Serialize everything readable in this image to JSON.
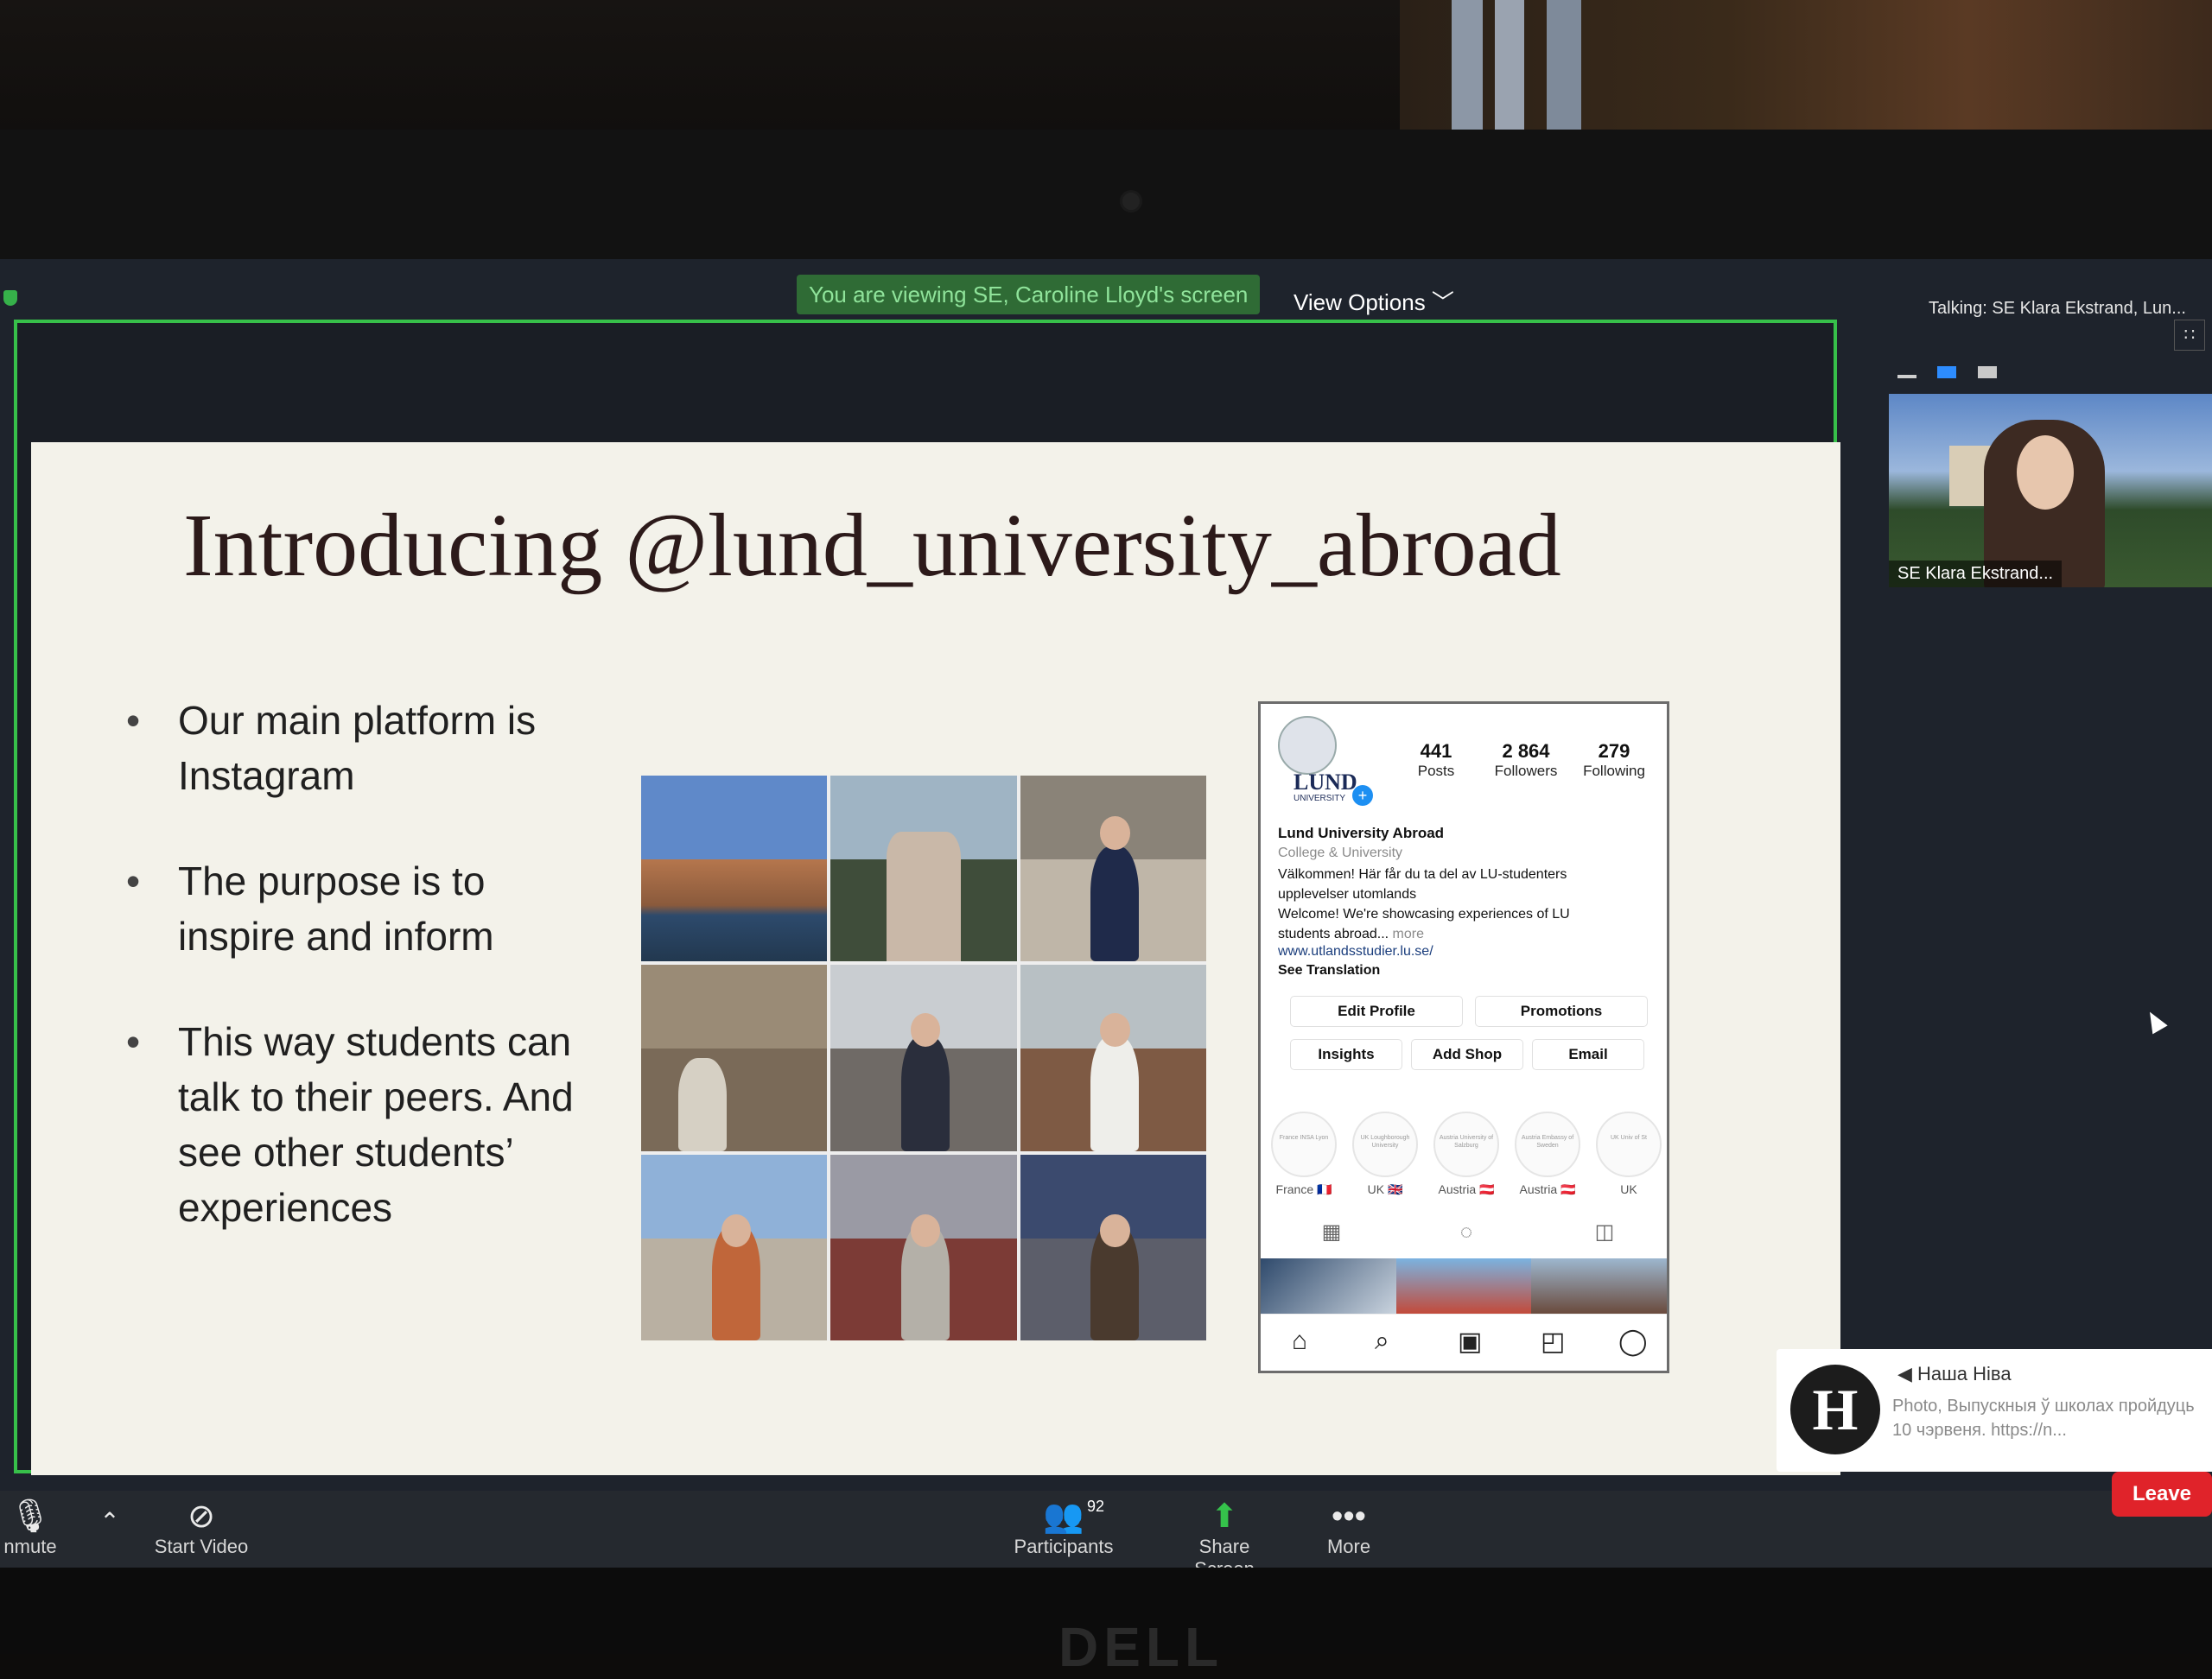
{
  "banner": {
    "viewing_text": "You are viewing SE, Caroline Lloyd's screen",
    "view_options": "View Options ﹀",
    "talking": "Talking: SE Klara Ekstrand, Lun..."
  },
  "slide": {
    "title": "Introducing @lund_university_abroad",
    "bullets": [
      "Our main platform is Instagram",
      "The purpose is to inspire and inform",
      "This way students can talk to their peers. And see other students’ experiences"
    ]
  },
  "instagram": {
    "logo_text": "LUND",
    "logo_subtext": "UNIVERSITY",
    "posts_count": "441",
    "posts_label": "Posts",
    "followers_count": "2 864",
    "followers_label": "Followers",
    "following_count": "279",
    "following_label": "Following",
    "name": "Lund University Abroad",
    "category": "College & University",
    "bio_line1": "Välkommen! Här får du ta del av LU-studenters",
    "bio_line2": "upplevelser utomlands",
    "bio_line3": "Welcome! We're showcasing experiences of LU",
    "bio_line4": "students abroad...",
    "bio_more": "more",
    "link": "www.utlandsstudier.lu.se/",
    "see_translation": "See Translation",
    "buttons": {
      "edit_profile": "Edit Profile",
      "promotions": "Promotions",
      "insights": "Insights",
      "add_shop": "Add Shop",
      "email": "Email"
    },
    "highlights": [
      {
        "ring_text": "France INSA Lyon",
        "caption": "France 🇫🇷"
      },
      {
        "ring_text": "UK Loughborough University",
        "caption": "UK 🇬🇧"
      },
      {
        "ring_text": "Austria University of Salzburg",
        "caption": "Austria 🇦🇹"
      },
      {
        "ring_text": "Austria Embassy of Sweden",
        "caption": "Austria 🇦🇹"
      },
      {
        "ring_text": "UK Univ of St",
        "caption": "UK"
      }
    ]
  },
  "video": {
    "participant_name": "SE Klara Ekstrand..."
  },
  "notification": {
    "logo_letter": "H",
    "title": "Наша Ніва",
    "text": "Photo, Выпускныя ў школах пройдуць 10 чэрвеня. https://n..."
  },
  "toolbar": {
    "unmute_label": "nmute",
    "start_video_label": "Start Video",
    "participants_label": "Participants",
    "participants_count": "92",
    "share_screen_label": "Share Screen",
    "more_label": "More",
    "leave_label": "Leave"
  },
  "device": {
    "brand": "DELL"
  },
  "colors": {
    "share_border": "#37c04a",
    "leave_red": "#e0232a",
    "banner_green": "#2f6b35",
    "ig_blue": "#1d8ff2"
  }
}
